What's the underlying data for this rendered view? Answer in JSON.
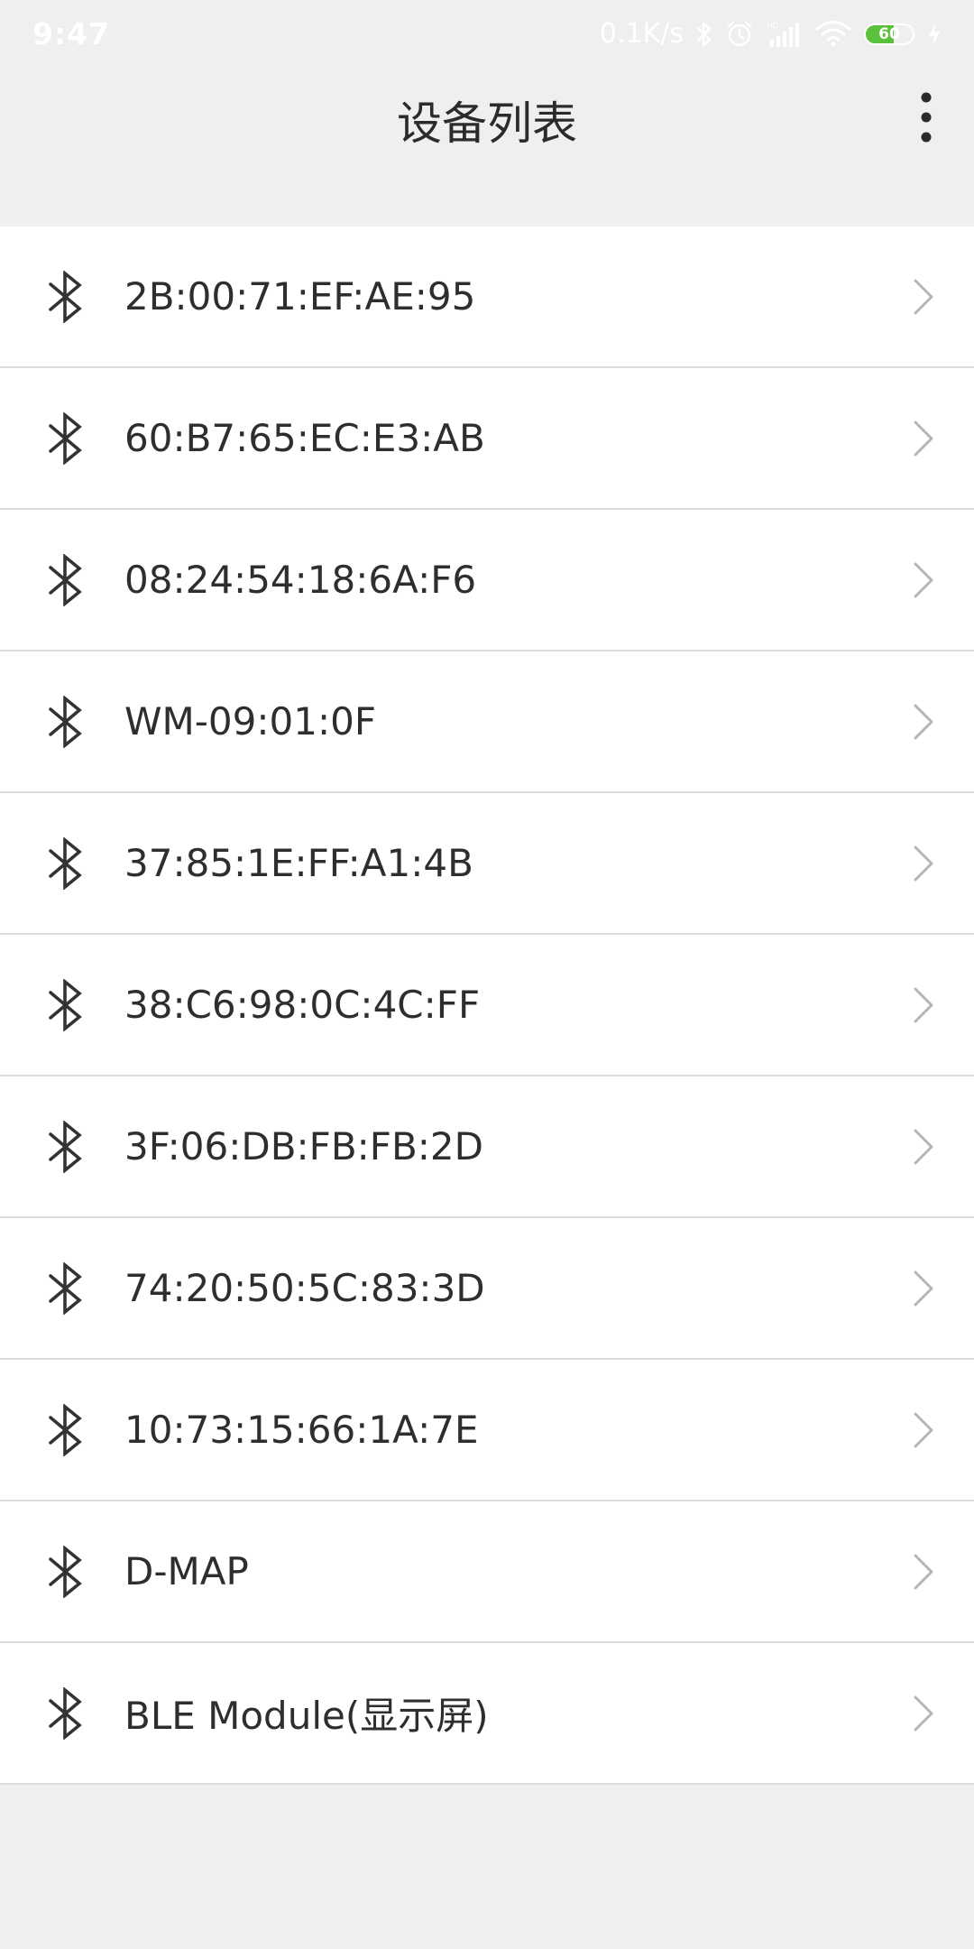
{
  "status_bar": {
    "time": "9:47",
    "net_speed": "0.1K/s",
    "battery_level": "60",
    "icons": [
      "bluetooth-icon",
      "alarm-icon",
      "hd-signal-icon",
      "wifi-icon",
      "battery-icon",
      "charging-icon"
    ]
  },
  "header": {
    "title": "设备列表",
    "menu_icon": "more-vertical-icon"
  },
  "devices": [
    {
      "name": "2B:00:71:EF:AE:95"
    },
    {
      "name": "60:B7:65:EC:E3:AB"
    },
    {
      "name": "08:24:54:18:6A:F6"
    },
    {
      "name": "WM-09:01:0F"
    },
    {
      "name": "37:85:1E:FF:A1:4B"
    },
    {
      "name": "38:C6:98:0C:4C:FF"
    },
    {
      "name": "3F:06:DB:FB:FB:2D"
    },
    {
      "name": "74:20:50:5C:83:3D"
    },
    {
      "name": "10:73:15:66:1A:7E"
    },
    {
      "name": "D-MAP"
    },
    {
      "name": "BLE Module(显示屏)"
    }
  ],
  "colors": {
    "background": "#efefef",
    "row_background": "#ffffff",
    "divider": "#dcdcdc",
    "text": "#2e2e2e",
    "chevron": "#b5b5b5",
    "battery_fill": "#5ac13c"
  }
}
